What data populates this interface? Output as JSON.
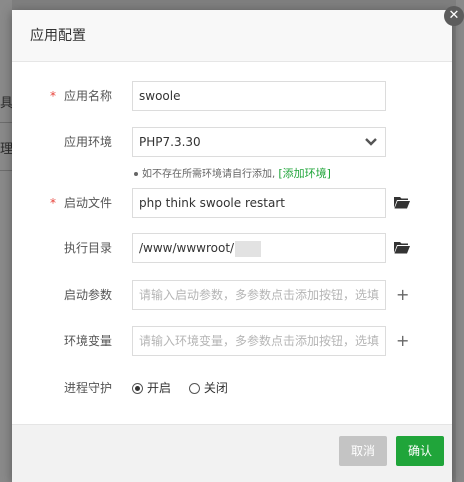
{
  "background": {
    "left_fragment_1": "具",
    "left_fragment_2": "理"
  },
  "dialog": {
    "title": "应用配置",
    "close_icon": "close-icon"
  },
  "form": {
    "required_mark": "*",
    "app_name": {
      "label": "应用名称",
      "value": "swoole"
    },
    "app_env": {
      "label": "应用环境",
      "value": "PHP7.3.30"
    },
    "hint": {
      "text": "如不存在所需环境请自行添加,",
      "link": "[添加环境]"
    },
    "start_file": {
      "label": "启动文件",
      "value": "php think swoole restart"
    },
    "exec_dir": {
      "label": "执行目录",
      "value": "/www/wwwroot/"
    },
    "start_params": {
      "label": "启动参数",
      "placeholder": "请输入启动参数，多参数点击添加按钮，选填"
    },
    "env_vars": {
      "label": "环境变量",
      "placeholder": "请输入环境变量，多参数点击添加按钮，选填"
    },
    "daemon": {
      "label": "进程守护",
      "on_label": "开启",
      "off_label": "关闭",
      "selected": "开启"
    },
    "plus": "+"
  },
  "footer": {
    "cancel_label": "取消",
    "confirm_label": "确认"
  },
  "colors": {
    "accent": "#20a53a",
    "required": "#e8443b",
    "cancel_disabled": "#c4c4c4"
  }
}
